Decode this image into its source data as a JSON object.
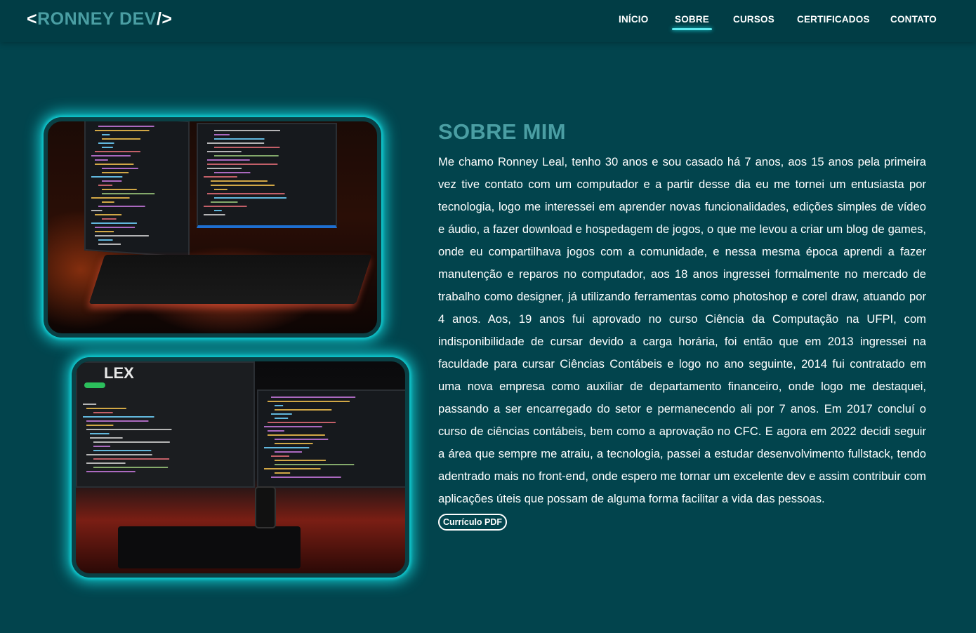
{
  "header": {
    "logo_open": "<",
    "logo_name": "RONNEY DEV",
    "logo_close": "/>",
    "nav": [
      {
        "label": "INÍCIO"
      },
      {
        "label": "SOBRE"
      },
      {
        "label": "CURSOS"
      },
      {
        "label": "CERTIFICADOS"
      },
      {
        "label": "CONTATO"
      }
    ],
    "active_nav": "SOBRE"
  },
  "about": {
    "title": "SOBRE MIM",
    "text": "Me chamo Ronney Leal, tenho 30 anos e sou casado há 7 anos, aos 15 anos pela primeira vez tive contato com um computador e a partir desse dia eu me tornei um entusiasta por tecnologia, logo me interessei em aprender novas funcionalidades, edições simples de vídeo e áudio, a fazer download e hospedagem de jogos, o que me levou a criar um blog de games, onde eu compartilhava jogos com a comunidade, e nessa mesma época aprendi a fazer manutenção e reparos no computador, aos 18 anos ingressei formalmente no mercado de trabalho como designer, já utilizando ferramentas como photoshop e corel draw, atuando por 4 anos. Aos, 19 anos fui aprovado no curso Ciência da Computação na UFPI, com indisponibilidade de cursar devido a carga horária, foi então que em 2013 ingressei na faculdade para cursar Ciências Contábeis e logo no ano seguinte, 2014 fui contratado em uma nova empresa como auxiliar de departamento financeiro, onde logo me destaquei, passando a ser encarregado do setor e permanecendo ali por 7 anos. Em 2017 concluí o curso de ciências contábeis, bem como a aprovação no CFC. E agora em 2022 decidi seguir a área que sempre me atraiu, a tecnologia, passei a estudar desenvolvimento fullstack, tendo adentrado mais no front-end, onde espero me tornar um excelente dev e assim contribuir com aplicações úteis que possam de alguma forma facilitar a vida das pessoas.",
    "cv_button": "Currículo PDF"
  },
  "photos": {
    "photo1_label": "",
    "photo2_logo": "LEX"
  },
  "colors": {
    "background": "#02444d",
    "header": "#013d45",
    "accent": "#4a9ea3",
    "glow": "#11c9cf"
  }
}
